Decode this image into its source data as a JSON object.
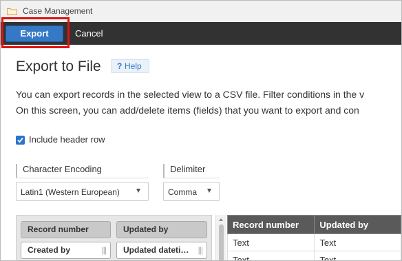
{
  "window": {
    "title": "Case Management"
  },
  "toolbar": {
    "export_label": "Export",
    "cancel_label": "Cancel"
  },
  "page": {
    "title": "Export to File",
    "help_label": "Help",
    "description_line1": "You can export records in the selected view to a CSV file. Filter conditions in the v",
    "description_line2": "On this screen, you can add/delete items (fields) that you want to export and con"
  },
  "options": {
    "include_header_label": "Include header row",
    "include_header_checked": true,
    "encoding_label": "Character Encoding",
    "encoding_value": "Latin1 (Western European)",
    "delimiter_label": "Delimiter",
    "delimiter_value": "Comma"
  },
  "fields": [
    {
      "label": "Record number",
      "style": "grey"
    },
    {
      "label": "Updated by",
      "style": "grey"
    },
    {
      "label": "Created by",
      "style": "white"
    },
    {
      "label": "Updated dateti…",
      "style": "white"
    }
  ],
  "preview": {
    "columns": [
      "Record number",
      "Updated by"
    ],
    "rows": [
      [
        "Text",
        "Text"
      ],
      [
        "Text",
        "Text"
      ]
    ]
  },
  "colors": {
    "accent": "#3478c6",
    "toolbar": "#323232",
    "highlight": "#e01414"
  },
  "icons": {
    "app": "folder-icon",
    "help": "question-icon",
    "checkbox": "checkmark-icon",
    "grip": "drag-handle-icon"
  }
}
